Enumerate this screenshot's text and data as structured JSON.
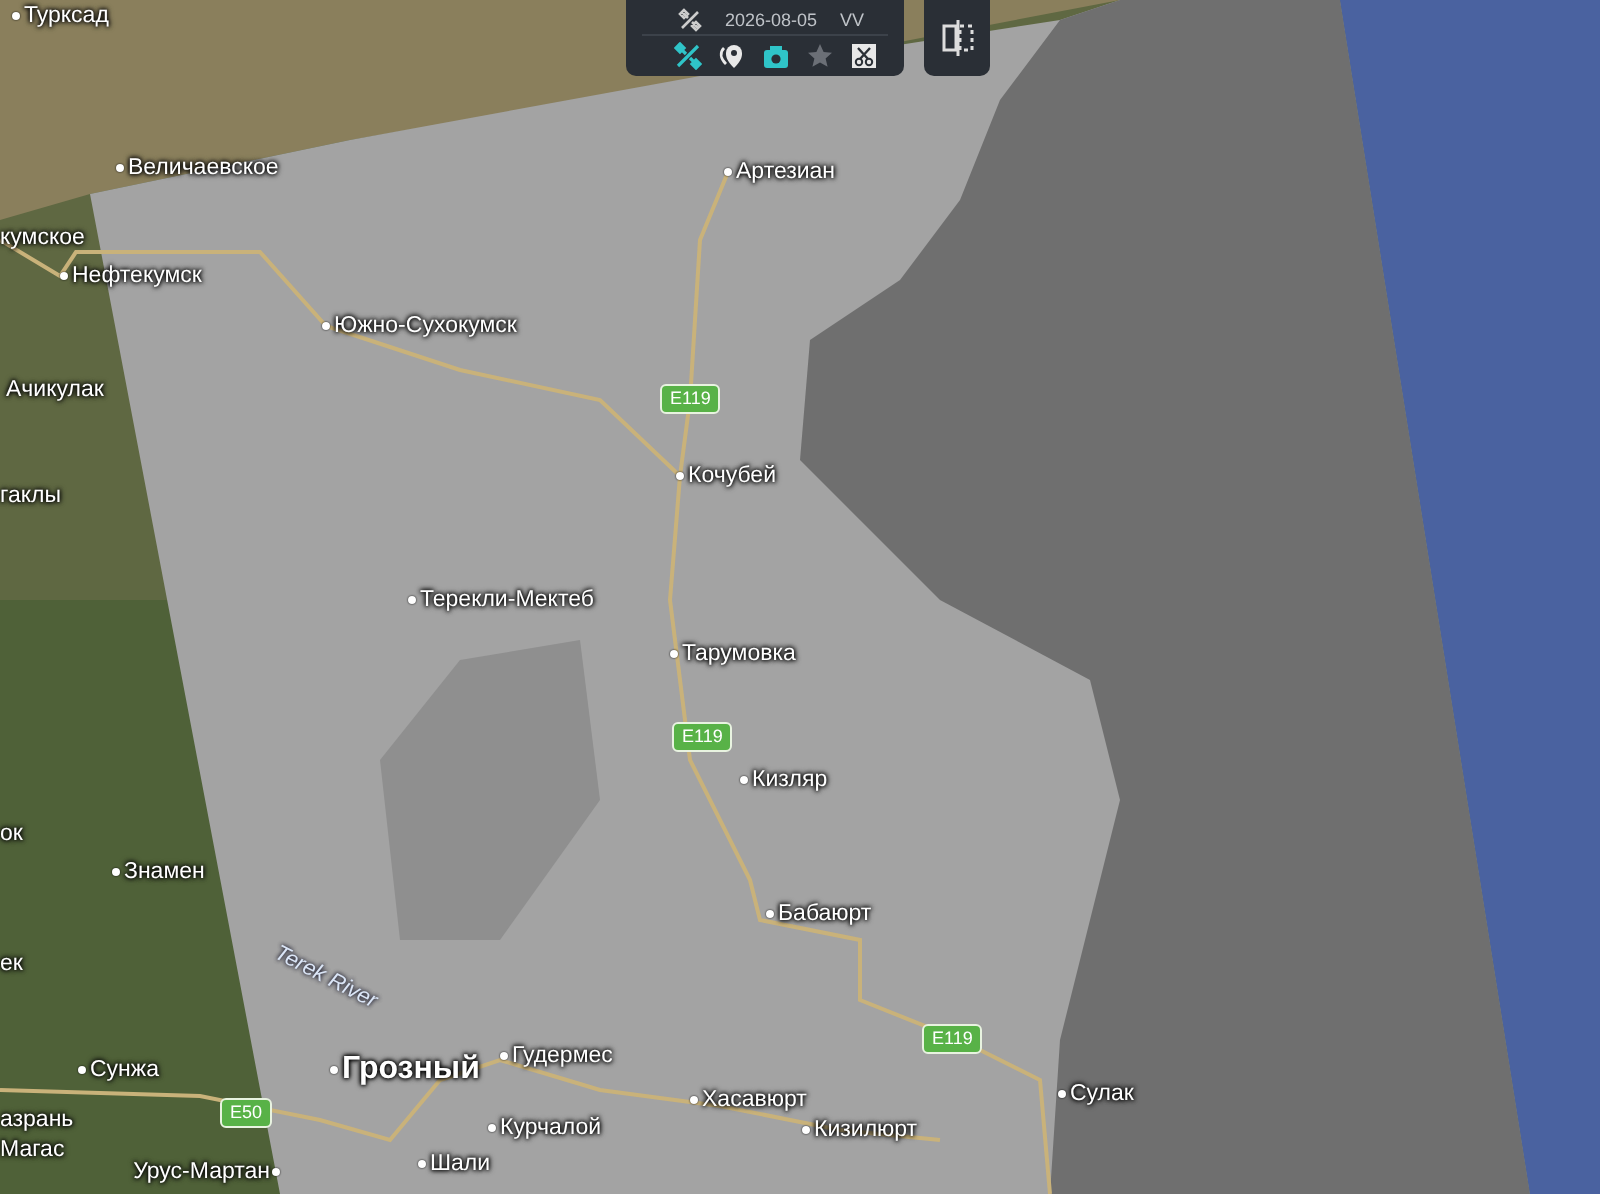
{
  "toolbar": {
    "date": "2026-08-05",
    "polarization": "VV",
    "tools": [
      {
        "kind": "satellite",
        "active": true,
        "disabled": false
      },
      {
        "kind": "pins",
        "active": false,
        "disabled": false
      },
      {
        "kind": "camera",
        "active": true,
        "disabled": false
      },
      {
        "kind": "star",
        "active": false,
        "disabled": true
      },
      {
        "kind": "scissors",
        "active": false,
        "disabled": false
      }
    ]
  },
  "map": {
    "places": [
      {
        "name": "Турксад",
        "kind": "town"
      },
      {
        "name": "Величаевское",
        "kind": "town"
      },
      {
        "name": "кумское",
        "kind": "edge"
      },
      {
        "name": "Нефтекумск",
        "kind": "town"
      },
      {
        "name": "Южно-Сухокумск",
        "kind": "town"
      },
      {
        "name": "Ачикулак",
        "kind": "edge"
      },
      {
        "name": "гаклы",
        "kind": "edge"
      },
      {
        "name": "Артезиан",
        "kind": "town"
      },
      {
        "name": "Кочубей",
        "kind": "town"
      },
      {
        "name": "Терекли-Мектеб",
        "kind": "town"
      },
      {
        "name": "Тарумовка",
        "kind": "town"
      },
      {
        "name": "Кизляр",
        "kind": "town"
      },
      {
        "name": "ок",
        "kind": "edge"
      },
      {
        "name": "Знамен",
        "kind": "town"
      },
      {
        "name": "Бабаюрт",
        "kind": "town"
      },
      {
        "name": "ек",
        "kind": "edge"
      },
      {
        "name": "Сулак",
        "kind": "town"
      },
      {
        "name": "Сунжа",
        "kind": "town"
      },
      {
        "name": "Грозный",
        "kind": "city"
      },
      {
        "name": "Гудермес",
        "kind": "town"
      },
      {
        "name": "Хасавюрт",
        "kind": "town"
      },
      {
        "name": "азрань",
        "kind": "edge"
      },
      {
        "name": "Курчалой",
        "kind": "town"
      },
      {
        "name": "Кизилюрт",
        "kind": "town"
      },
      {
        "name": "Магас",
        "kind": "edge"
      },
      {
        "name": "Урус-Мартан",
        "kind": "town-right"
      },
      {
        "name": "Шали",
        "kind": "town"
      }
    ],
    "rivers": [
      {
        "name": "Terek River"
      }
    ],
    "road_badges": [
      {
        "label": "E119"
      },
      {
        "label": "E119"
      },
      {
        "label": "E119"
      },
      {
        "label": "E50"
      }
    ]
  }
}
